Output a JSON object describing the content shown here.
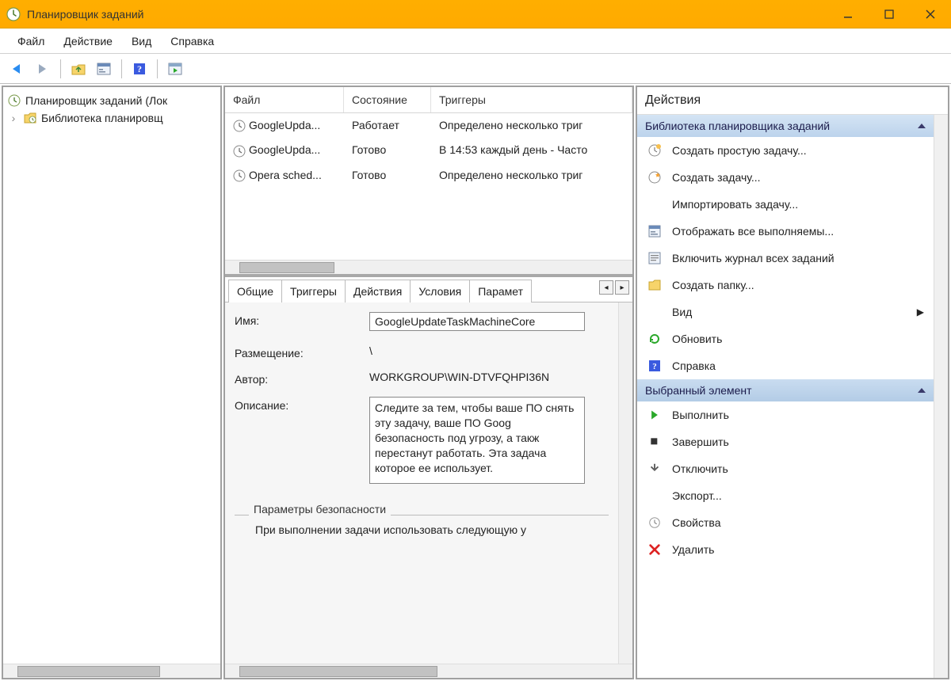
{
  "window": {
    "title": "Планировщик заданий"
  },
  "menu": {
    "file": "Файл",
    "action": "Действие",
    "view": "Вид",
    "help": "Справка"
  },
  "tree": {
    "root": "Планировщик заданий (Лок",
    "library": "Библиотека планировщ"
  },
  "task_list": {
    "columns": {
      "file": "Файл",
      "state": "Состояние",
      "triggers": "Триггеры"
    },
    "rows": [
      {
        "file": "GoogleUpda...",
        "state": "Работает",
        "triggers": "Определено несколько триг"
      },
      {
        "file": "GoogleUpda...",
        "state": "Готово",
        "triggers": "В 14:53 каждый день - Часто"
      },
      {
        "file": "Opera sched...",
        "state": "Готово",
        "triggers": "Определено несколько триг"
      }
    ]
  },
  "tabs": {
    "general": "Общие",
    "triggers": "Триггеры",
    "actions": "Действия",
    "conditions": "Условия",
    "settings": "Парамет"
  },
  "details": {
    "name_label": "Имя:",
    "name_value": "GoogleUpdateTaskMachineCore",
    "location_label": "Размещение:",
    "location_value": "\\",
    "author_label": "Автор:",
    "author_value": "WORKGROUP\\WIN-DTVFQHPI36N",
    "description_label": "Описание:",
    "description_value": "Следите за тем, чтобы ваше ПО снять эту задачу, ваше ПО Goog безопасность под угрозу, а такж перестанут работать. Эта задача которое ее использует.",
    "security_label": "Параметры безопасности",
    "security_line": "При выполнении задачи использовать следующую у"
  },
  "actions_pane": {
    "title": "Действия",
    "group1": "Библиотека планировщика заданий",
    "items1": [
      "Создать простую задачу...",
      "Создать задачу...",
      "Импортировать задачу...",
      "Отображать все выполняемы...",
      "Включить журнал всех заданий",
      "Создать папку...",
      "Вид",
      "Обновить",
      "Справка"
    ],
    "group2": "Выбранный элемент",
    "items2": [
      "Выполнить",
      "Завершить",
      "Отключить",
      "Экспорт...",
      "Свойства",
      "Удалить"
    ]
  }
}
